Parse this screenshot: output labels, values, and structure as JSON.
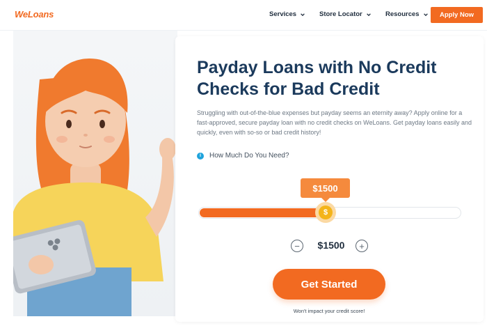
{
  "header": {
    "logo_we": "We",
    "logo_loans": "Loans",
    "nav": [
      {
        "label": "Services"
      },
      {
        "label": "Store Locator"
      },
      {
        "label": "Resources"
      }
    ],
    "apply_label": "Apply Now"
  },
  "hero": {
    "title_line1": "Payday Loans with No Credit",
    "title_line2": "Checks for Bad Credit",
    "subtitle": "Struggling with out-of-the-blue expenses but payday seems an eternity away? Apply online for a fast-approved, secure payday loan with no credit checks on WeLoans. Get payday loans easily and quickly, even with so-so or bad credit history!"
  },
  "calculator": {
    "question": "How Much Do You Need?",
    "info_icon": "i",
    "amount_tip": "$1500",
    "slider_fraction": 0.48,
    "thumb_symbol": "$",
    "minus_symbol": "−",
    "plus_symbol": "+",
    "amount_value": "$1500",
    "cta_label": "Get Started",
    "disclaimer": "Won't impact your credit score!"
  },
  "colors": {
    "accent": "#f26a21",
    "title": "#1b3a5c",
    "info": "#1fa3dc"
  },
  "icons": {
    "nav_chevron": "chevron-down-icon",
    "illustration": "woman-with-tablet-illustration"
  }
}
